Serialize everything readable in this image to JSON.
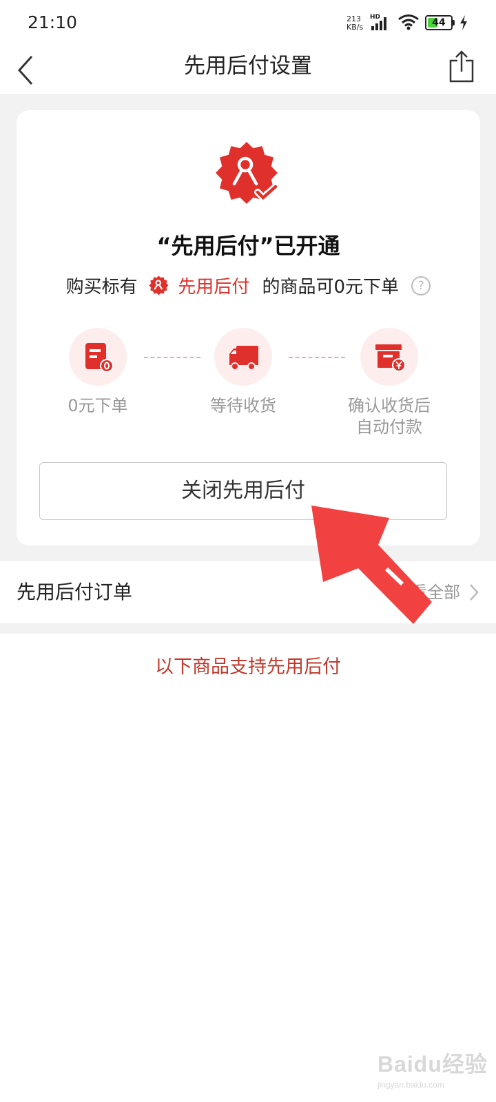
{
  "status_bar": {
    "time": "21:10",
    "net_speed_value": "213",
    "net_speed_unit": "KB/s",
    "network_label": "HD",
    "battery_level": "44",
    "battery_fraction": 0.44
  },
  "header": {
    "title": "先用后付设置",
    "back_icon": "chevron-left-icon",
    "share_icon": "share-icon"
  },
  "card": {
    "title": "“先用后付”已开通",
    "subtitle_prefix": "购买标有",
    "subtitle_highlight": "先用后付",
    "subtitle_suffix": "的商品可0元下单",
    "help_symbol": "?",
    "steps": [
      {
        "icon": "order-document-icon",
        "label": "0元下单"
      },
      {
        "icon": "delivery-truck-icon",
        "label": "等待收货"
      },
      {
        "icon": "payment-box-icon",
        "label": "确认收货后\n自动付款"
      }
    ],
    "close_button_label": "关闭先用后付"
  },
  "orders": {
    "label": "先用后付订单",
    "view_all_label": "查看全部"
  },
  "products": {
    "heading": "以下商品支持先用后付"
  },
  "watermark": {
    "brand": "Baidu经验",
    "url": "jingyan.baidu.com"
  },
  "colors": {
    "accent": "#e0302b",
    "heading_red": "#c0392b",
    "step_bg": "#fdeeed",
    "arrow": "#f04444"
  }
}
